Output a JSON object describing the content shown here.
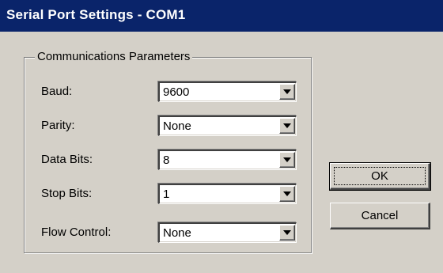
{
  "window": {
    "title": "Serial Port Settings - COM1"
  },
  "group": {
    "label": "Communications Parameters"
  },
  "fields": {
    "baud": {
      "label": "Baud:",
      "value": "9600"
    },
    "parity": {
      "label": "Parity:",
      "value": "None"
    },
    "data_bits": {
      "label": "Data Bits:",
      "value": "8"
    },
    "stop_bits": {
      "label": "Stop Bits:",
      "value": "1"
    },
    "flow_control": {
      "label": "Flow Control:",
      "value": "None"
    }
  },
  "buttons": {
    "ok": "OK",
    "cancel": "Cancel"
  },
  "colors": {
    "titlebar": "#0a246a",
    "face": "#d4d0c8"
  }
}
